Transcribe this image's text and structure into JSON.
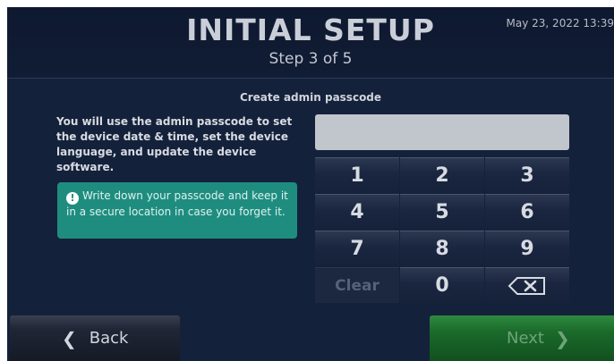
{
  "header": {
    "title": "INITIAL SETUP",
    "step": "Step 3 of 5",
    "datetime": "May 23, 2022 13:39"
  },
  "prompt": "Create admin passcode",
  "info_text": "You will use the admin passcode to set the device date & time, set the device language, and update the device software.",
  "alert": {
    "icon": "exclamation-icon",
    "text": "Write down your passcode and keep it in a secure location in case you forget it."
  },
  "passcode_field": {
    "value": ""
  },
  "keypad": {
    "keys": [
      "1",
      "2",
      "3",
      "4",
      "5",
      "6",
      "7",
      "8",
      "9"
    ],
    "clear": "Clear",
    "zero": "0",
    "backspace_icon": "backspace-icon"
  },
  "footer": {
    "back_label": "Back",
    "next_label": "Next"
  },
  "colors": {
    "background": "#14213a",
    "alert": "#1e8d80",
    "next_button": "#1b6b2b"
  }
}
